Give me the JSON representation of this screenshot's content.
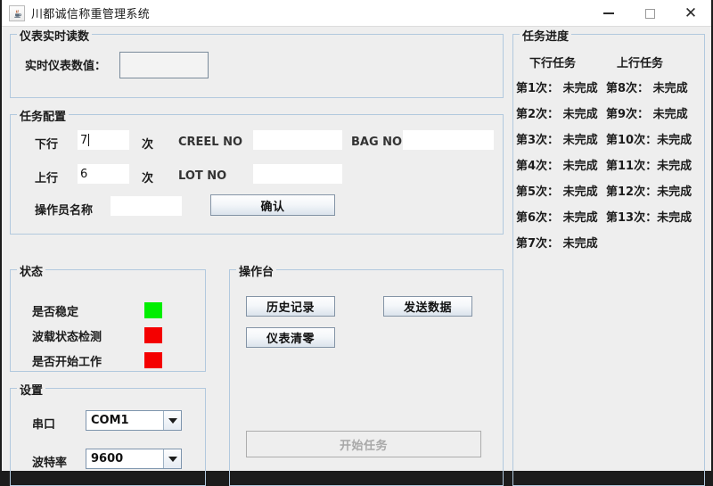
{
  "window": {
    "title": "川都诚信称重管理系统",
    "app_icon": "java-coffee-cup-icon",
    "controls": {
      "minimize": "minimize-icon",
      "maximize": "maximize-icon",
      "close": "close-icon"
    }
  },
  "meter_panel": {
    "title": "仪表实时读数",
    "label": "实时仪表数值：",
    "value": ""
  },
  "task_config": {
    "title": "任务配置",
    "down_label": "下行",
    "down_value": "7",
    "down_unit": "次",
    "up_label": "上行",
    "up_value": "6",
    "up_unit": "次",
    "creel_no_label": "CREEL NO",
    "creel_no_value": "",
    "bag_no_label": "BAG NO",
    "bag_no_value": "",
    "lot_no_label": "LOT NO",
    "lot_no_value": "",
    "operator_label": "操作员名称",
    "operator_value": "",
    "confirm_button": "确认"
  },
  "status_panel": {
    "title": "状态",
    "rows": [
      {
        "label": "是否稳定",
        "color": "#00ee00"
      },
      {
        "label": "波载状态检测",
        "color": "#f40000"
      },
      {
        "label": "是否开始工作",
        "color": "#f40000"
      }
    ]
  },
  "settings_panel": {
    "title": "设置",
    "port_label": "串口",
    "port_value": "COM1",
    "baud_label": "波特率",
    "baud_value": "9600"
  },
  "console_panel": {
    "title": "操作台",
    "history_button": "历史记录",
    "send_button": "发送数据",
    "tare_button": "仪表清零",
    "start_button": "开始任务",
    "start_disabled": true
  },
  "task_progress": {
    "title": "任务进度",
    "down_header": "下行任务",
    "up_header": "上行任务",
    "down_rows": [
      {
        "name": "第1次：",
        "status": "未完成"
      },
      {
        "name": "第2次：",
        "status": "未完成"
      },
      {
        "name": "第3次：",
        "status": "未完成"
      },
      {
        "name": "第4次：",
        "status": "未完成"
      },
      {
        "name": "第5次：",
        "status": "未完成"
      },
      {
        "name": "第6次：",
        "status": "未完成"
      },
      {
        "name": "第7次：",
        "status": "未完成"
      }
    ],
    "up_rows": [
      {
        "name": "第8次：",
        "status": "未完成"
      },
      {
        "name": "第9次：",
        "status": "未完成"
      },
      {
        "name": "第10次：",
        "status": "未完成"
      },
      {
        "name": "第11次：",
        "status": "未完成"
      },
      {
        "name": "第12次：",
        "status": "未完成"
      },
      {
        "name": "第13次：",
        "status": "未完成"
      }
    ]
  }
}
